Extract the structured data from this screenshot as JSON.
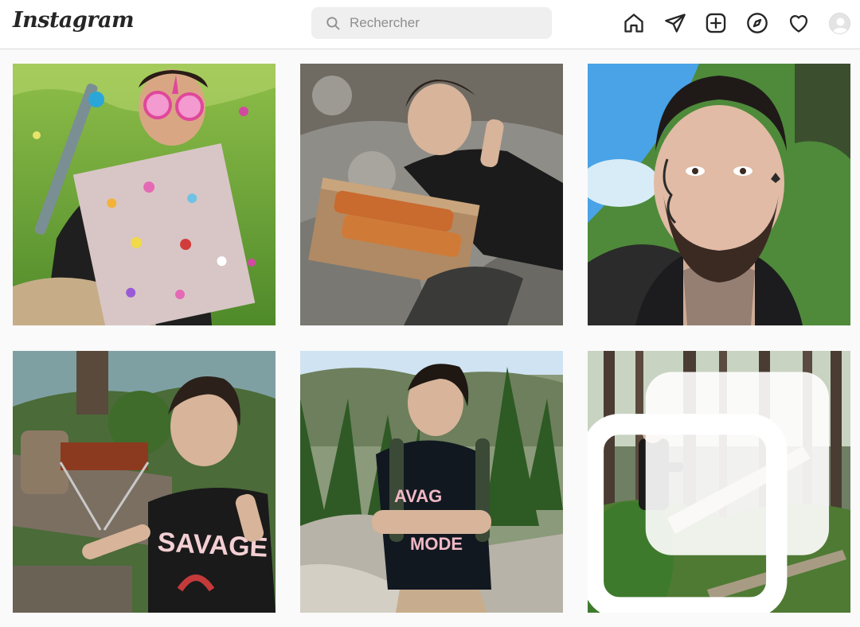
{
  "header": {
    "logo_text": "Instagram",
    "search_placeholder": "Rechercher",
    "search_value": "",
    "nav_icons": [
      "home-icon",
      "direct-messages-icon",
      "new-post-icon",
      "explore-icon",
      "activity-heart-icon",
      "profile-avatar"
    ]
  },
  "colors": {
    "topbar_bg": "#ffffff",
    "page_bg": "#fafafa",
    "search_bg": "#efefef",
    "border": "#dbdbdb"
  },
  "posts": [
    {
      "subject": "man with unicorn glasses and decorated box",
      "multi": false
    },
    {
      "subject": "man giving thumbs up with grilled meat on stone",
      "multi": false
    },
    {
      "subject": "close-up selfie of tattooed bearded man",
      "multi": false
    },
    {
      "subject": "man flashing peace sign near campfire grill",
      "multi": false
    },
    {
      "subject": "man with backpack in mountains wearing SAVAGE MODE shirt",
      "multi": false
    },
    {
      "subject": "man in forest by fallen tree",
      "multi": true
    }
  ],
  "shirt_text": {
    "post4": "SAVAGE",
    "post5_top": "AVAG",
    "post5_bottom": "MODE"
  }
}
